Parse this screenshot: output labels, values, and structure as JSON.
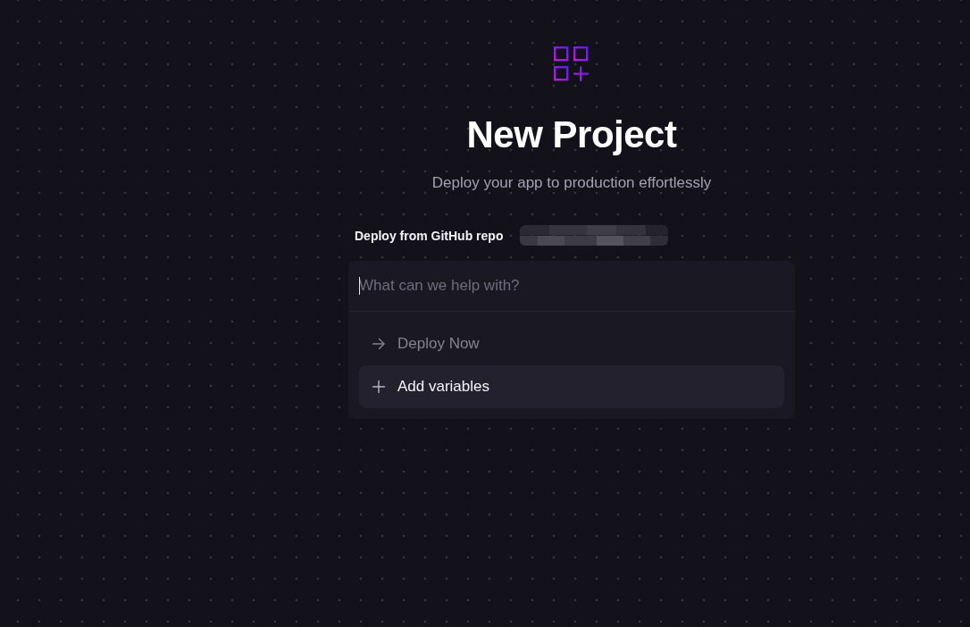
{
  "title": "New Project",
  "subtitle": "Deploy your app to production effortlessly",
  "source": {
    "label": "Deploy from GitHub repo"
  },
  "prompt": {
    "placeholder": "What can we help with?",
    "focused": true
  },
  "actions": [
    {
      "kind": "arrow",
      "label": "Deploy Now",
      "selected": false
    },
    {
      "kind": "plus",
      "label": "Add variables",
      "selected": true
    }
  ]
}
